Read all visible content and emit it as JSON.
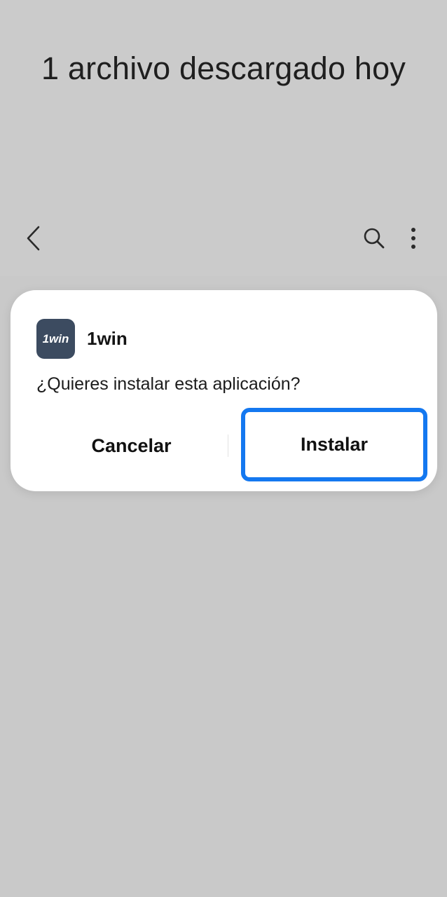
{
  "header": {
    "title": "1 archivo descargado hoy"
  },
  "toolbar": {
    "back_icon": "chevron-left-icon",
    "search_icon": "search-icon",
    "more_icon": "more-vertical-icon"
  },
  "dialog": {
    "app_icon_label": "1win",
    "app_icon_color": "#3c4b60",
    "app_name": "1win",
    "question": "¿Quieres instalar esta aplicación?",
    "cancel_label": "Cancelar",
    "install_label": "Instalar",
    "install_highlight_color": "#1478f0"
  }
}
